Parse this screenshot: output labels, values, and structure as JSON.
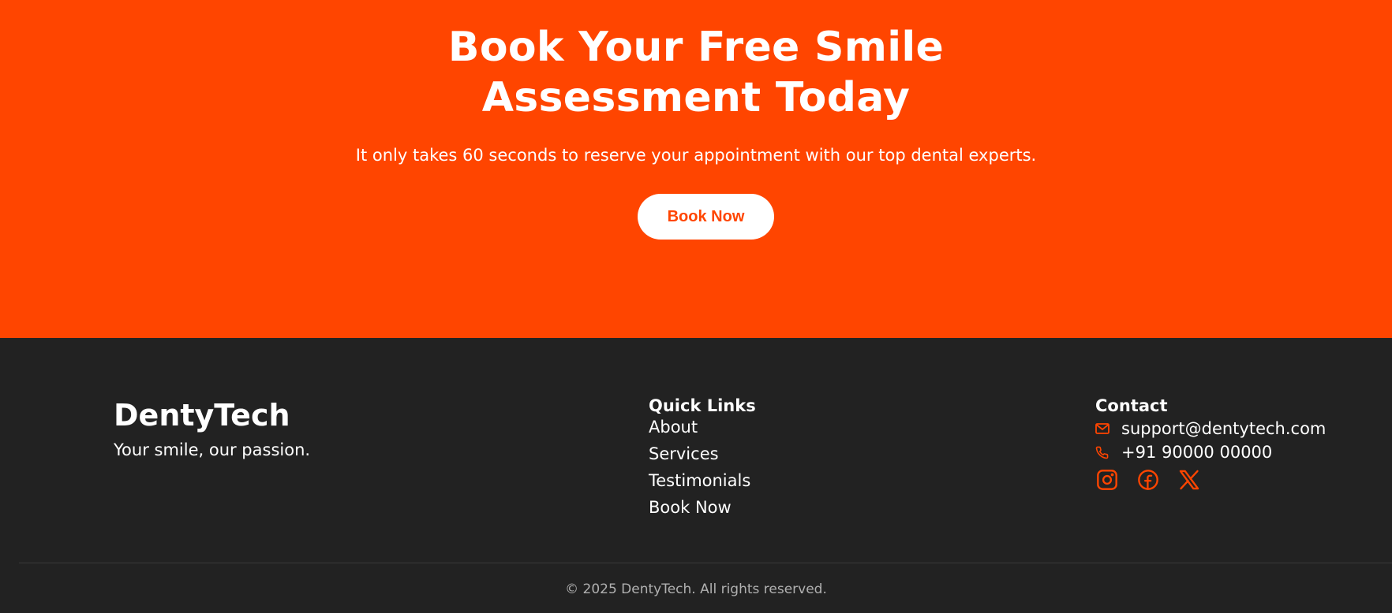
{
  "cta": {
    "title": "Book Your Free Smile Assessment Today",
    "subtitle": "It only takes 60 seconds to reserve your appointment with our top dental experts.",
    "button_label": "Book Now"
  },
  "footer": {
    "brand": "DentyTech",
    "tagline": "Your smile, our passion.",
    "quick_links": {
      "title": "Quick Links",
      "items": [
        "About",
        "Services",
        "Testimonials",
        "Book Now"
      ]
    },
    "contact": {
      "title": "Contact",
      "email": "support@dentytech.com",
      "phone": "+91 90000 00000",
      "socials": [
        "instagram-icon",
        "facebook-icon",
        "x-icon"
      ]
    },
    "copyright": "© 2025 DentyTech. All rights reserved."
  },
  "colors": {
    "accent": "#ff4500",
    "footer_bg": "#222222",
    "text_light": "#ffffff",
    "muted": "#b0b0b0"
  }
}
